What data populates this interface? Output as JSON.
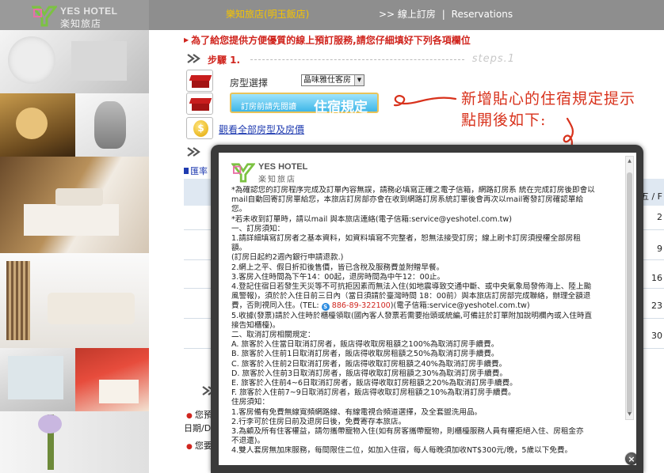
{
  "header": {
    "logo_en": "YES HOTEL",
    "logo_zh": "楽知旅店",
    "hotel_name": "樂知旅店(明玉飯店)",
    "nav_online_booking": ">> 線上訂房",
    "nav_separator": "|",
    "nav_reservations": "Reservations"
  },
  "form": {
    "notice": "為了給您提供方便優質的線上預訂服務,請您仔細填好下列各項欄位",
    "step1_label": "步驟 1.",
    "step1_watermark": "steps.1",
    "roomtype_label": "房型選擇",
    "roomtype_selected": "晶味雅仕客房",
    "policy_button_small": "訂房前請先閱讀",
    "policy_button_big": "住宿規定",
    "view_rooms_link": "觀看全部房型及房價",
    "coin_symbol": "$"
  },
  "background": {
    "tab_fragment": "匯率",
    "col_header": "五 / F",
    "col_values": [
      "2",
      "9",
      "16",
      "23",
      "30"
    ],
    "bottom_line1": "您預",
    "bottom_line2": "日期/D",
    "bottom_line3": "您要"
  },
  "annotation": {
    "line1": "新增貼心的住宿規定提示",
    "line2": "點開後如下:",
    "color": "#d8321c"
  },
  "modal": {
    "logo_en": "YES HOTEL",
    "logo_zh": "楽知旅店",
    "terms": [
      "*為確認您的訂房程序完成及訂單內容無誤，請務必填寫正確之電子信箱，網路訂房系 統在完成訂房後即會以",
      "mail自動回寄訂房單給您，本旅店訂房部亦會在收到網路訂房系統訂單後會再次以mail寄發訂房確認單給",
      "您。",
      "*若未收到訂單時，請以mail 與本旅店連絡(電子信箱:service@yeshotel.com.tw)",
      "一、訂房須知：",
      "1.請詳細填寫訂房者之基本資料，如資料填寫不完整者，恕無法接受訂房；線上刷卡訂房須授權全部房租",
      "額。",
      "(訂房日起約2週內銀行申請退款.)",
      "2.網上之平、假日折扣後售價，皆已含稅及服務費並附贈早餐。",
      "3.客房入住時間為下午14：00起，退房時間為中午12：00止。",
      "4.登記住宿日若發生天災等不可抗拒因素而無法入住(如地震導致交通中斷、或中央氣象局發佈海上、陸上颱",
      "風警報)，須於於入住日前三日內（當日須請於臺灣時間 18：00前）與本旅店訂房部完成聯絡，辦理全額退",
      "費，否則視同入住。(TEL:",
      "886-89-322100",
      ")(電子信箱:service@yeshotel.com.tw)",
      "5.收據(發票)請於入住時於櫃檯領取(國內客人發票若需要抬頭或統編,可備註於訂單附加說明欄內或入住時直",
      "接告知櫃檯)。",
      "二、取消訂房相關規定：",
      "A. 旅客於入住當日取消訂房者，飯店得收取房租額之100%為取消訂房手續費。",
      "B. 旅客於入住前1日取消訂房者，飯店得收取房租額之50%為取消訂房手續費。",
      "C. 旅客於入住前2日取消訂房者，飯店得收取訂房租額之40%為取消訂房手續費。",
      "D. 旅客於入住前3日取消訂房者，飯店得收取訂房租額之30%為取消訂房手續費。",
      "E. 旅客於入住前4~6日取消訂房者，飯店得收取訂房租額之20%為取消訂房手續費。",
      "F. 旅客於入住前7~9日取消訂房者，飯店得收取訂房租額之10%為取消訂房手續費。",
      "住房須知：",
      "1.客房備有免費無線寬頻網路線、有線電視合頻道選擇，及全套盥洗用品。",
      "2.行李可於住房日前及退房日後，免費寄存本旅店。",
      "3.為顧及所有住客權益，請勿攜帶寵物入住(如有房客攜帶寵物，則櫃檯服務人員有權拒絕入住、房租金亦",
      "不退還)。",
      "4.雙人套房無加床服務，每間限住二位，如加入住宿，每人每晚須加收NT$300元/晚，5歲以下免費。"
    ],
    "close_symbol": "×",
    "s_icon": "S"
  },
  "colors": {
    "header_bg": "#8e8e8e",
    "hotel_name": "#f5c400",
    "notice_red": "#d0251e",
    "link_blue": "#1f3bb0",
    "policy_button": "#3fb6e8"
  }
}
